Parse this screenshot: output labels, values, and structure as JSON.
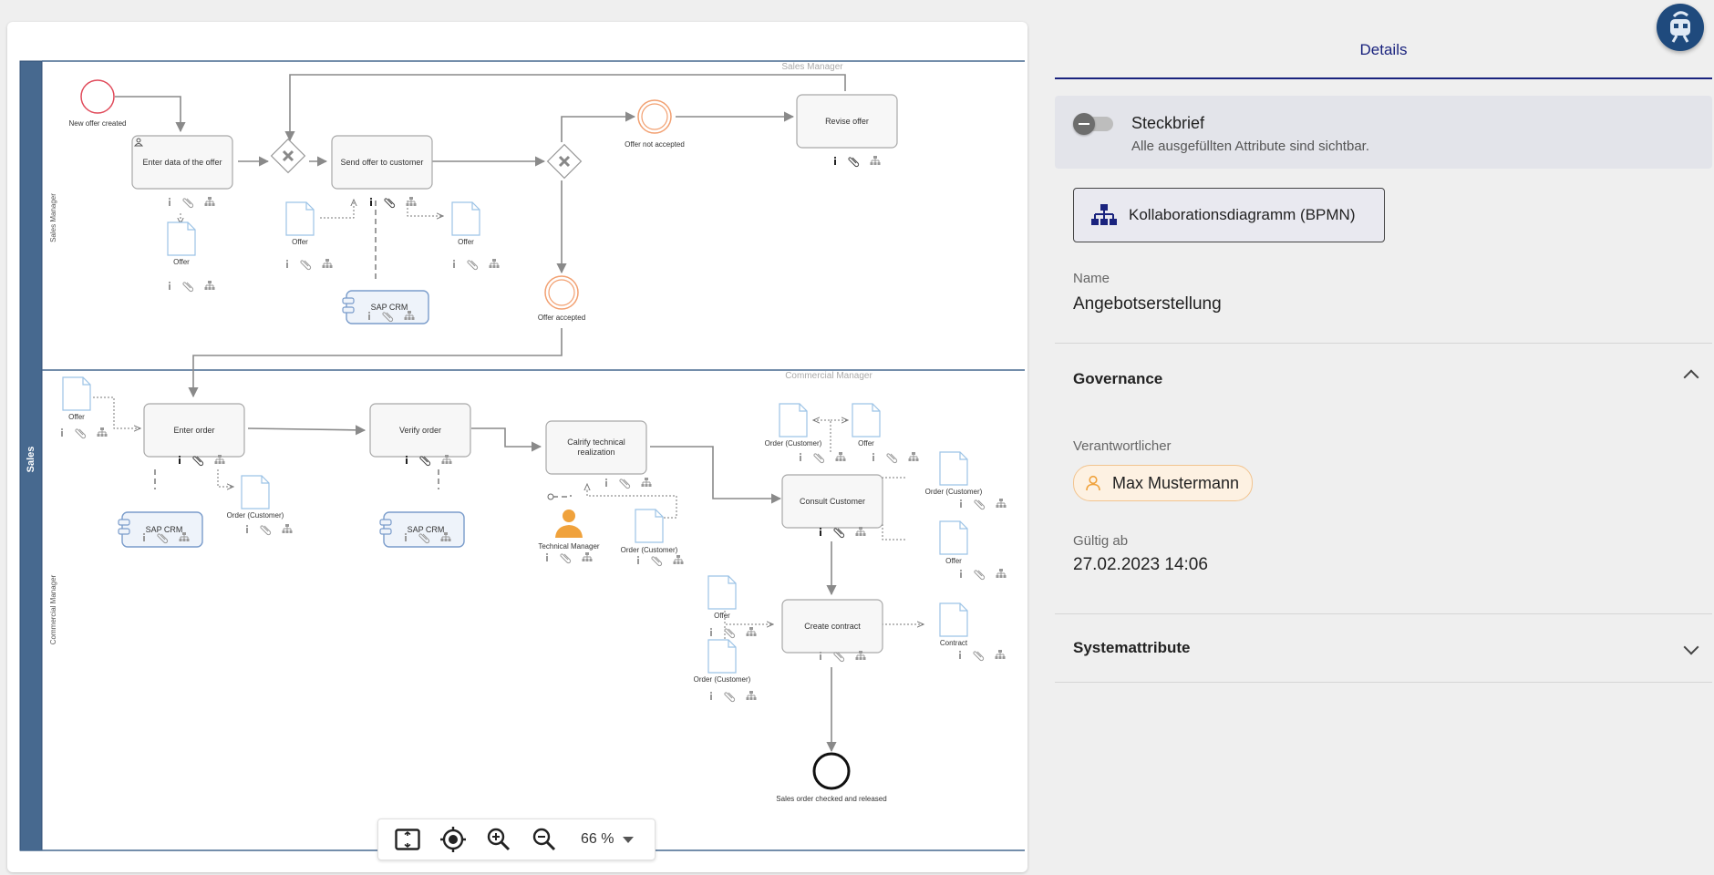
{
  "diagram": {
    "pool_label": "Sales",
    "lanes": [
      "Sales Manager",
      "Commercial Manager"
    ],
    "lane_header_labels": [
      "Sales Manager",
      "Commercial Manager"
    ],
    "events": {
      "new_offer_created": "New offer created",
      "offer_not_accepted": "Offer not accepted",
      "offer_accepted": "Offer accepted",
      "sales_order_checked": "Sales order checked and released"
    },
    "tasks": {
      "enter_data": "Enter data of the offer",
      "send_offer": "Send offer to customer",
      "revise_offer": "Revise offer",
      "enter_order": "Enter order",
      "verify_order": "Verify order",
      "clarify_1": "Calrify technical",
      "clarify_2": "realization",
      "consult_customer": "Consult Customer",
      "create_contract": "Create contract"
    },
    "systems": {
      "sap_crm": "SAP CRM"
    },
    "data_objects": {
      "offer": "Offer",
      "order_customer": "Order (Customer)",
      "contract": "Contract"
    },
    "roles": {
      "technical_manager": "Technical Manager"
    }
  },
  "zoom": {
    "level": "66 %"
  },
  "panel": {
    "tab_label": "Details",
    "steckbrief": {
      "title": "Steckbrief",
      "subtitle": "Alle ausgefüllten Attribute sind sichtbar.",
      "enabled": false
    },
    "diagram_type_button": "Kollaborationsdiagramm (BPMN)",
    "name_label": "Name",
    "name_value": "Angebotserstellung",
    "governance": {
      "title": "Governance",
      "responsible_label": "Verantwortlicher",
      "responsible_value": "Max Mustermann",
      "valid_from_label": "Gültig ab",
      "valid_from_value": "27.02.2023 14:06"
    },
    "system_attributes_title": "Systemattribute"
  },
  "colors": {
    "pool_bar": "#47698f",
    "accent": "#1a237e",
    "start_event": "#e04a5a",
    "intermediate_event": "#f2a071",
    "chip_border": "#f2c48f",
    "role_icon": "#f0a23c"
  },
  "icons": [
    "info-icon",
    "attachment-icon",
    "hierarchy-icon",
    "fit-to-screen-icon",
    "center-icon",
    "zoom-in-icon",
    "zoom-out-icon",
    "chevron-up-icon",
    "chevron-down-icon",
    "org-chart-icon",
    "person-icon",
    "assistant-avatar-icon"
  ]
}
